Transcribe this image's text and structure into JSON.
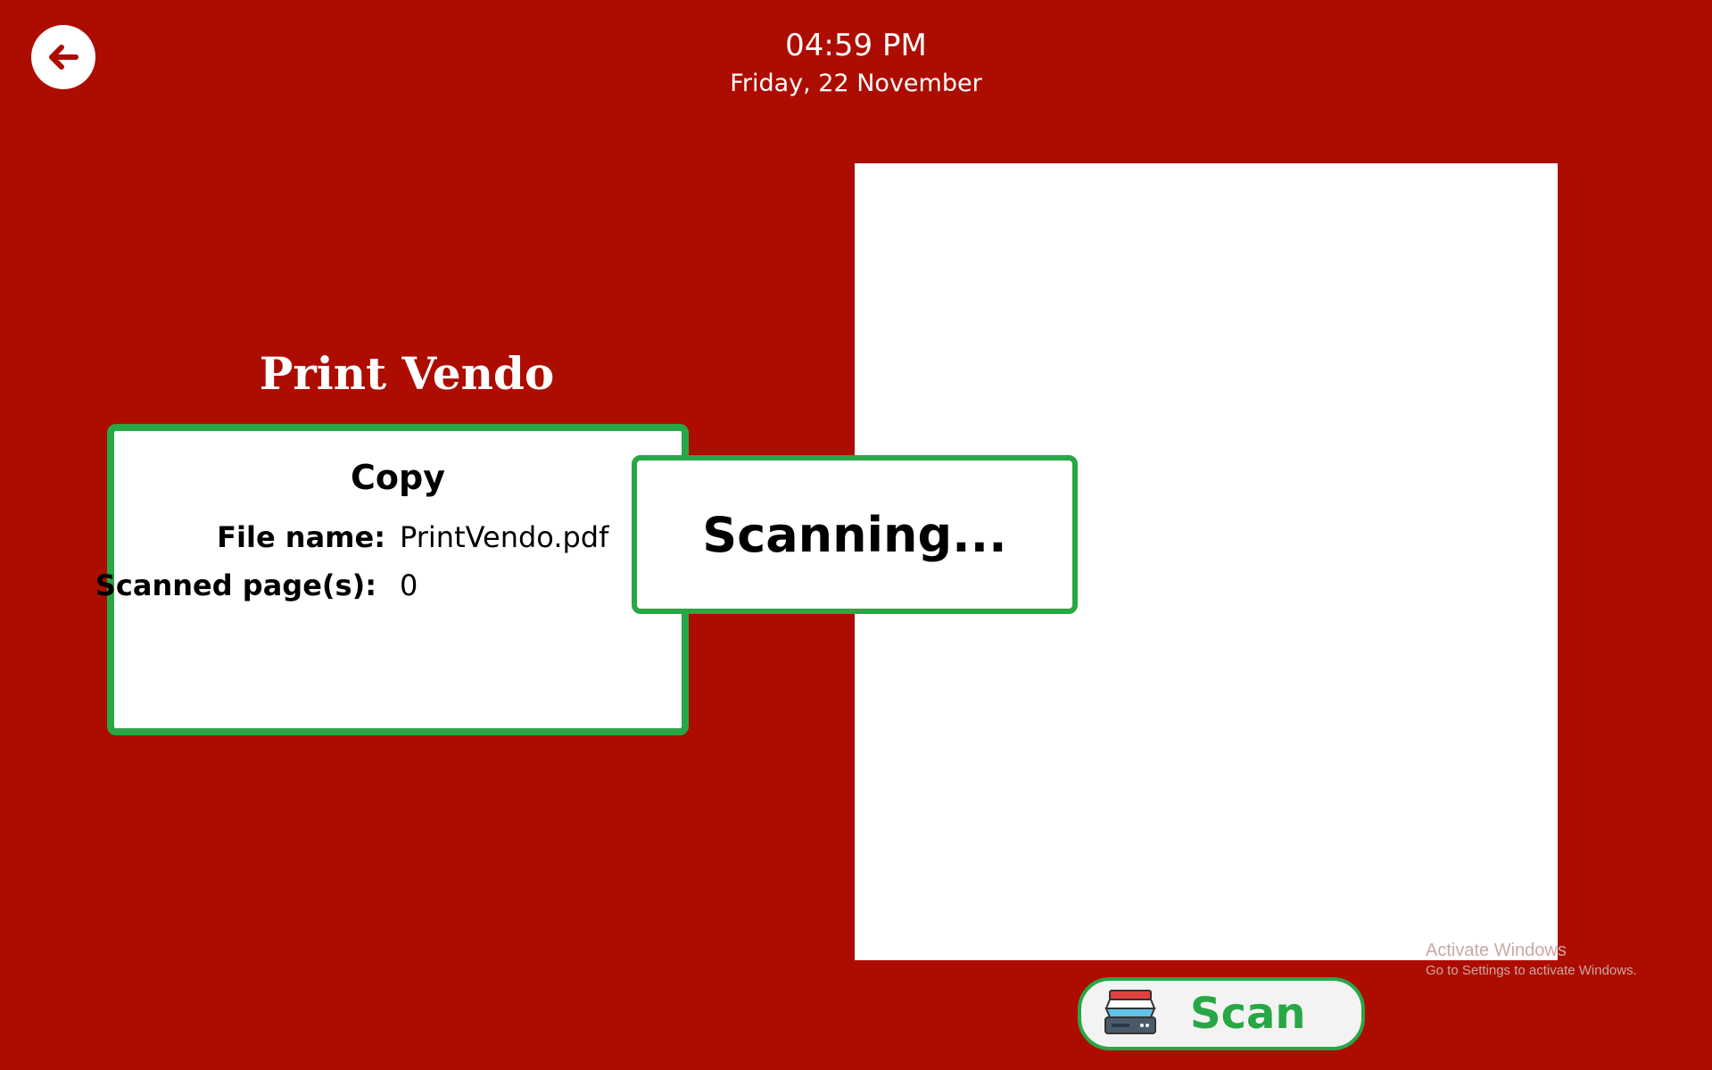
{
  "header": {
    "time": "04:59 PM",
    "date": "Friday, 22 November",
    "back_icon": "arrow-left-icon"
  },
  "brand": {
    "title": "Print Vendo"
  },
  "info_card": {
    "title": "Copy",
    "file_name_label": "File name:",
    "file_name_value": "PrintVendo.pdf",
    "scanned_pages_label": "Scanned page(s):",
    "scanned_pages_value": "0"
  },
  "modal": {
    "text": "Scanning..."
  },
  "scan_button": {
    "label": "Scan",
    "icon": "scanner-icon"
  },
  "watermark": {
    "line1": "Activate Windows",
    "line2": "Go to Settings to activate Windows."
  },
  "colors": {
    "background": "#ad0d00",
    "accent_green": "#28a745",
    "panel": "#ffffff"
  }
}
